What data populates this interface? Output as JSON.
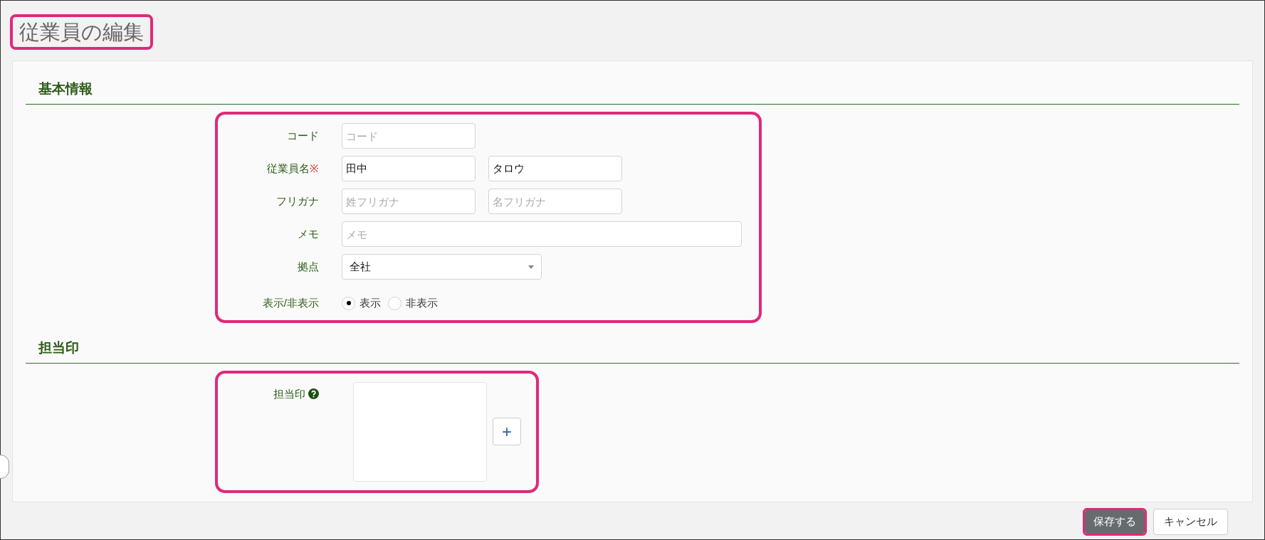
{
  "page_title": "従業員の編集",
  "sections": [
    {
      "heading": "基本情報",
      "rows": [
        {
          "kind": "inputs",
          "label": "コード",
          "fields": [
            {
              "placeholder": "コード"
            }
          ]
        },
        {
          "kind": "inputs",
          "label": "従業員名",
          "required_mark": "※",
          "fields": [
            {
              "value": "田中"
            },
            {
              "value": "タロウ"
            }
          ]
        },
        {
          "kind": "inputs",
          "label": "フリガナ",
          "fields": [
            {
              "placeholder": "姓フリガナ"
            },
            {
              "placeholder": "名フリガナ"
            }
          ]
        },
        {
          "kind": "wide_input",
          "label": "メモ",
          "fields": [
            {
              "placeholder": "メモ"
            }
          ]
        },
        {
          "kind": "select",
          "label": "拠点",
          "value": "全社"
        },
        {
          "kind": "radio",
          "label": "表示/非表示",
          "options": [
            {
              "label": "表示",
              "selected": true
            },
            {
              "label": "非表示",
              "selected": false
            }
          ]
        }
      ]
    },
    {
      "heading": "担当印",
      "rows": [
        {
          "kind": "stamp",
          "label": "担当印",
          "add_button": "+"
        }
      ]
    }
  ],
  "buttons": [
    {
      "label": "保存する",
      "kind": "primary"
    },
    {
      "label": "キャンセル",
      "kind": "default"
    }
  ]
}
